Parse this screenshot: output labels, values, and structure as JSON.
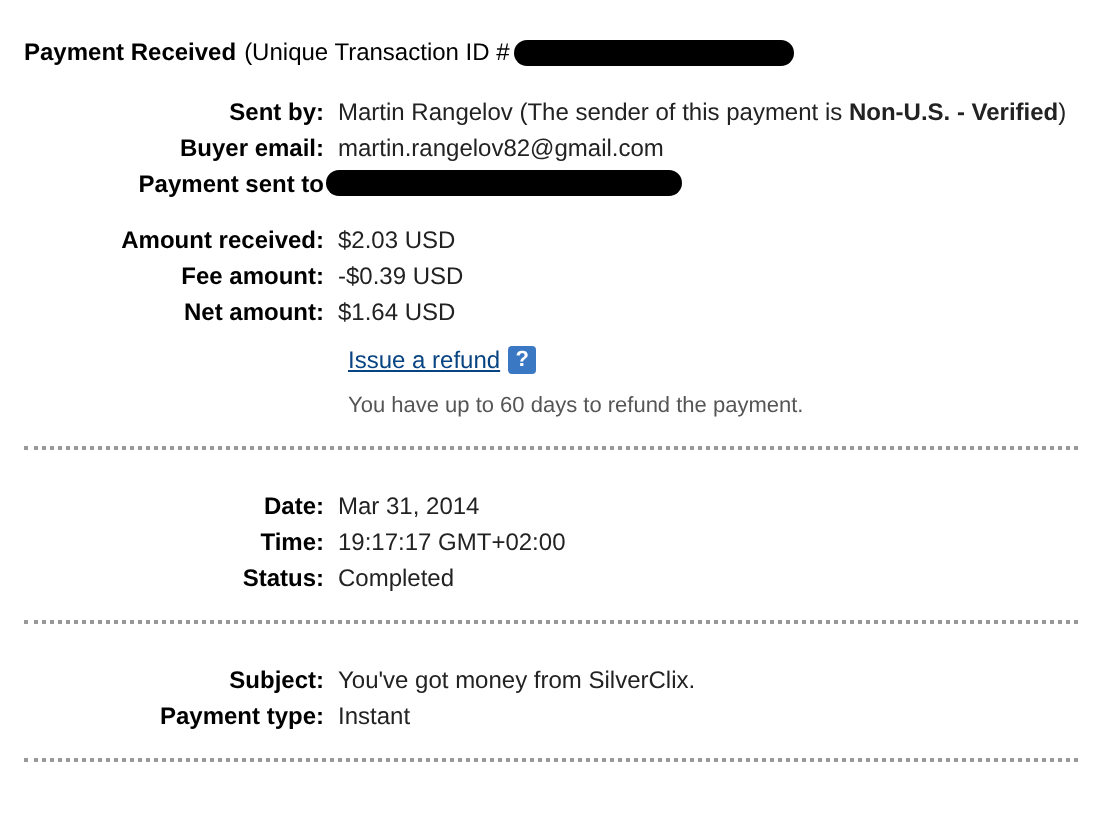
{
  "header": {
    "title": "Payment Received",
    "subtitle": "(Unique Transaction ID #",
    "redacted": true
  },
  "sections": [
    {
      "groups": [
        [
          {
            "kind": "text",
            "label": "Sent by:",
            "value": "Martin Rangelov (The sender of this payment is **Non-U.S. - Verified**)"
          },
          {
            "kind": "text",
            "label": "Buyer email:",
            "value": "martin.rangelov82@gmail.com"
          },
          {
            "kind": "redacted",
            "label": "Payment sent to"
          }
        ],
        [
          {
            "kind": "text",
            "label": "Amount received:",
            "value": "$2.03 USD"
          },
          {
            "kind": "text",
            "label": "Fee amount:",
            "value": "-$0.39 USD"
          },
          {
            "kind": "text",
            "label": "Net amount:",
            "value": "$1.64 USD"
          }
        ]
      ],
      "refund": {
        "link": "Issue a refund",
        "help": "?",
        "note": "You have up to 60 days to refund the payment."
      }
    },
    {
      "groups": [
        [
          {
            "kind": "text",
            "label": "Date:",
            "value": "Mar 31, 2014"
          },
          {
            "kind": "text",
            "label": "Time:",
            "value": "19:17:17 GMT+02:00"
          },
          {
            "kind": "text",
            "label": "Status:",
            "value": "Completed"
          }
        ]
      ]
    },
    {
      "groups": [
        [
          {
            "kind": "text",
            "label": "Subject:",
            "value": "You've got money from SilverClix."
          },
          {
            "kind": "text",
            "label": "Payment type:",
            "value": "Instant"
          }
        ]
      ]
    }
  ]
}
